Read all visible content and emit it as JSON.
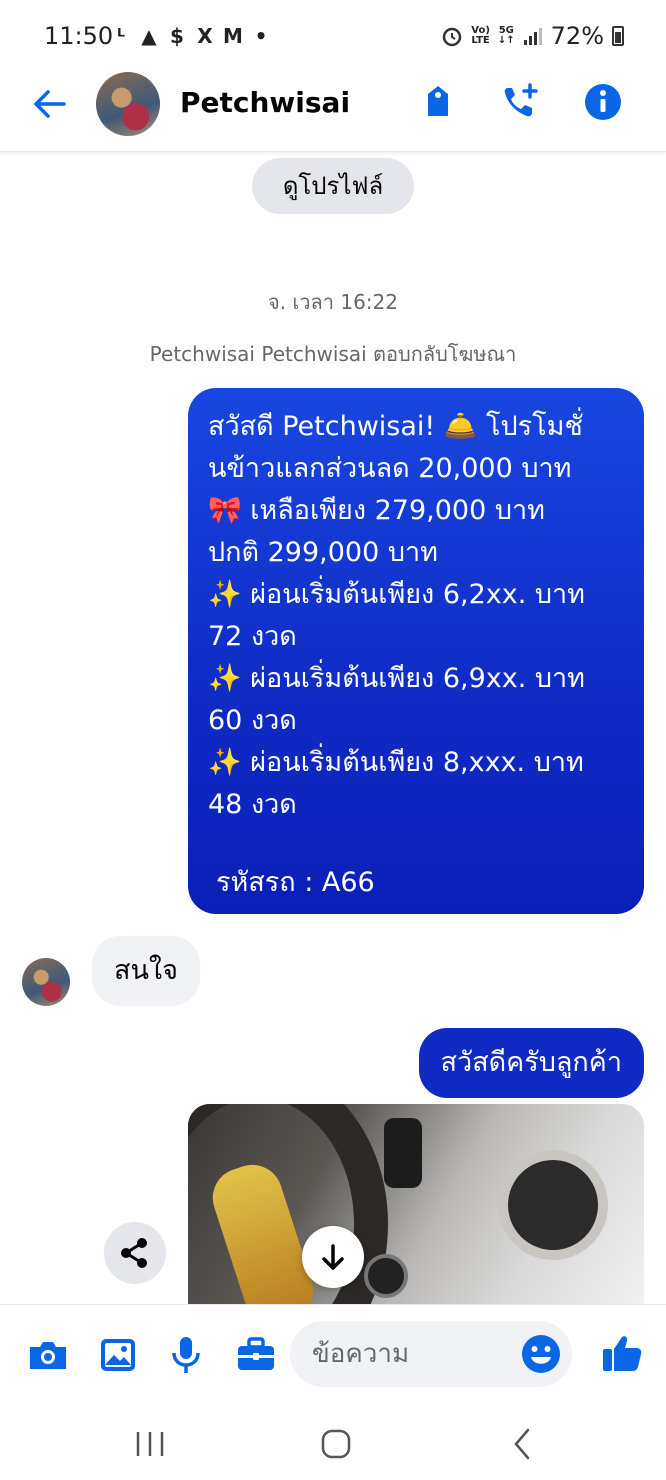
{
  "status_bar": {
    "time": "11:50",
    "left_icons": [
      "line-icon",
      "warning-icon",
      "shop-icon",
      "x-icon",
      "m-icon",
      "dot-icon"
    ],
    "left_glyphs": [
      "ᴸ",
      "▲",
      "$",
      "X",
      "M",
      "•"
    ],
    "volte_top": "Vo)",
    "volte_bottom": "LTE",
    "net_top": "5G",
    "net_bottom": "↓↑",
    "battery": "72%"
  },
  "header": {
    "contact_name": "Petchwisai",
    "accent_color": "#0a66e4"
  },
  "conversation": {
    "view_profile_label": "ดูโปรไฟล์",
    "timestamp": "จ. เวลา 16:22",
    "ad_reply_note": "Petchwisai Petchwisai ตอบกลับโฆษณา",
    "promo_lines": [
      "สวัสดี Petchwisai! 🛎️ โปรโมชั่",
      "นข้าวแลกส่วนลด 20,000 บาท",
      "🎀 เหลือเพียง 279,000 บาท",
      "ปกติ 299,000 บาท",
      "✨ ผ่อนเริ่มต้นเพียง 6,2xx. บาท",
      "72 งวด",
      "✨ ผ่อนเริ่มต้นเพียง 6,9xx. บาท",
      "60 งวด",
      "✨ ผ่อนเริ่มต้นเพียง 8,xxx. บาท",
      "48 งวด"
    ],
    "promo_code": "รหัสรถ : A66",
    "incoming_message": "สนใจ",
    "greeting_message": "สวัสดีครับลูกค้า"
  },
  "composer": {
    "placeholder": "ข้อความ"
  }
}
